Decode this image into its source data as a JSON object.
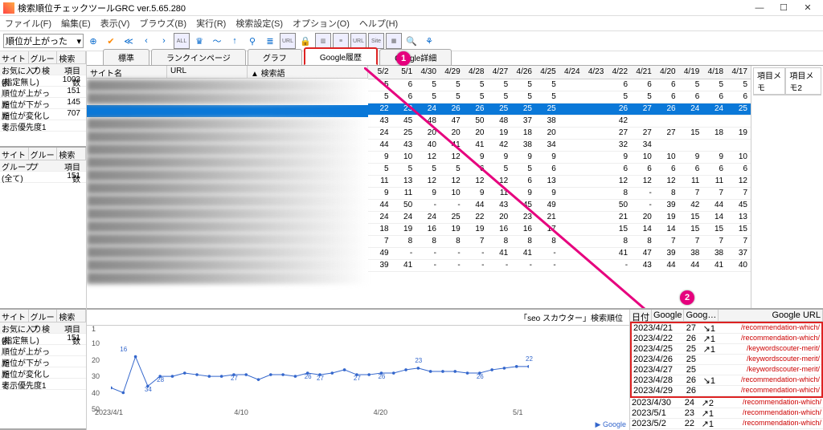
{
  "title": "検索順位チェックツールGRC  ver.5.65.280",
  "menu": [
    "ファイル(F)",
    "編集(E)",
    "表示(V)",
    "ブラウズ(B)",
    "実行(R)",
    "検索設定(S)",
    "オプション(O)",
    "ヘルプ(H)"
  ],
  "dropdown": "順位が上がった",
  "tabs": [
    "標準",
    "ランクインページ",
    "グラフ",
    "Google履歴",
    "Google詳細"
  ],
  "active_tab": 3,
  "badge1": "1",
  "badge2": "2",
  "left_panel1": {
    "head": [
      "サイト",
      "グループ",
      "検索"
    ],
    "subhead": [
      "お気に入り検索",
      "項目数"
    ],
    "rows": [
      [
        "(指定無し)",
        "1003"
      ],
      [
        "順位が上がった",
        "151"
      ],
      [
        "順位が下がった",
        "145"
      ],
      [
        "順位が変化して…",
        "707"
      ],
      [
        "表示優先度1",
        ""
      ]
    ]
  },
  "left_panel2": {
    "head": [
      "サイト",
      "グループ",
      "検索"
    ],
    "subhead": [
      "グループ",
      "項目数"
    ],
    "rows": [
      [
        "(全て)",
        "151"
      ]
    ]
  },
  "left_panel3": {
    "head": [
      "サイト",
      "グループ",
      "検索"
    ],
    "subhead": [
      "お気に入り検索",
      "項目数"
    ],
    "rows": [
      [
        "(指定無し)",
        "151"
      ],
      [
        "順位が上がった",
        ""
      ],
      [
        "順位が下がった",
        ""
      ],
      [
        "順位が変化して…",
        ""
      ],
      [
        "表示優先度1",
        ""
      ]
    ]
  },
  "grid_left_head": [
    "サイト名",
    "URL",
    "▲ 検索語"
  ],
  "memo_tabs": [
    "項目メモ",
    "項目メモ2"
  ],
  "date_cols": [
    "5/2",
    "5/1",
    "4/30",
    "4/29",
    "4/28",
    "4/27",
    "4/26",
    "4/25",
    "4/24",
    "4/23",
    "4/22",
    "4/21",
    "4/20",
    "4/19",
    "4/18",
    "4/17"
  ],
  "rank_rows": [
    [
      5,
      6,
      5,
      5,
      5,
      5,
      5,
      5,
      "",
      "",
      6,
      6,
      6,
      5,
      5,
      5
    ],
    [
      5,
      6,
      5,
      5,
      5,
      5,
      5,
      5,
      "",
      "",
      5,
      5,
      6,
      6,
      6,
      6
    ],
    [
      22,
      23,
      24,
      26,
      26,
      25,
      25,
      25,
      "",
      "",
      26,
      27,
      26,
      24,
      24,
      25
    ],
    [
      43,
      45,
      48,
      47,
      50,
      48,
      37,
      38,
      "",
      "",
      42,
      "",
      "",
      "",
      "",
      ""
    ],
    [
      24,
      25,
      20,
      20,
      20,
      19,
      18,
      20,
      "",
      "",
      27,
      27,
      27,
      15,
      18,
      19
    ],
    [
      44,
      43,
      40,
      41,
      41,
      42,
      38,
      34,
      "",
      "",
      32,
      34,
      "",
      "",
      "",
      ""
    ],
    [
      9,
      10,
      12,
      12,
      9,
      9,
      9,
      9,
      "",
      "",
      9,
      10,
      10,
      9,
      9,
      10
    ],
    [
      5,
      5,
      5,
      5,
      6,
      5,
      5,
      6,
      "",
      "",
      6,
      6,
      6,
      6,
      6,
      6
    ],
    [
      11,
      13,
      12,
      12,
      12,
      12,
      6,
      13,
      "",
      "",
      12,
      12,
      12,
      11,
      11,
      12
    ],
    [
      9,
      11,
      9,
      10,
      9,
      11,
      9,
      9,
      "",
      "",
      8,
      "-",
      8,
      7,
      7,
      7
    ],
    [
      44,
      50,
      "-",
      "-",
      44,
      43,
      45,
      49,
      "",
      "",
      50,
      "-",
      39,
      42,
      44,
      45
    ],
    [
      24,
      24,
      24,
      25,
      22,
      20,
      23,
      21,
      "",
      "",
      21,
      20,
      19,
      15,
      14,
      13
    ],
    [
      18,
      19,
      16,
      19,
      19,
      16,
      16,
      17,
      "",
      "",
      15,
      14,
      14,
      15,
      15,
      15
    ],
    [
      7,
      8,
      8,
      8,
      7,
      8,
      8,
      8,
      "",
      "",
      8,
      8,
      7,
      7,
      7,
      7
    ],
    [
      49,
      "-",
      "-",
      "-",
      "-",
      41,
      41,
      "-",
      "",
      "",
      41,
      47,
      39,
      38,
      38,
      37
    ],
    [
      39,
      41,
      "-",
      "-",
      "-",
      "-",
      "-",
      "-",
      "",
      "",
      "-",
      43,
      44,
      44,
      41,
      40
    ]
  ],
  "sel_row": 2,
  "chart_title": "「seo スカウター」検索順位",
  "chart_data": {
    "type": "line",
    "ylim": [
      1,
      50
    ],
    "y_ticks": [
      1,
      10,
      20,
      30,
      40,
      50
    ],
    "x_ticks": [
      "2023/4/1",
      "4/10",
      "4/20",
      "5/1"
    ],
    "values": [
      35,
      38,
      16,
      34,
      28,
      28,
      26,
      27,
      28,
      28,
      27,
      27,
      30,
      27,
      27,
      28,
      26,
      27,
      26,
      24,
      27,
      27,
      26,
      26,
      24,
      23,
      25,
      25,
      25,
      26,
      26,
      24,
      23,
      22,
      22
    ],
    "labels": [
      [
        1,
        16
      ],
      [
        3,
        34
      ],
      [
        4,
        28
      ],
      [
        10,
        27
      ],
      [
        16,
        26
      ],
      [
        17,
        27
      ],
      [
        20,
        27
      ],
      [
        22,
        26
      ],
      [
        25,
        23
      ],
      [
        30,
        26
      ],
      [
        34,
        22
      ]
    ]
  },
  "google_legend": "▶ Google",
  "hist_head": [
    "日付",
    "Google",
    "Goog…",
    "Google URL"
  ],
  "hist_rows": [
    [
      "2023/4/21",
      "27",
      "↘1",
      "/recommendation-which/"
    ],
    [
      "2023/4/22",
      "26",
      "↗1",
      "/recommendation-which/"
    ],
    [
      "2023/4/25",
      "25",
      "↗1",
      "/keywordscouter-merit/"
    ],
    [
      "2023/4/26",
      "25",
      "",
      "/keywordscouter-merit/"
    ],
    [
      "2023/4/27",
      "25",
      "",
      "/keywordscouter-merit/"
    ],
    [
      "2023/4/28",
      "26",
      "↘1",
      "/recommendation-which/"
    ],
    [
      "2023/4/29",
      "26",
      "",
      "/recommendation-which/"
    ]
  ],
  "hist_rows2": [
    [
      "2023/4/30",
      "24",
      "↗2",
      "/recommendation-which/"
    ],
    [
      "2023/5/1",
      "23",
      "↗1",
      "/recommendation-which/"
    ],
    [
      "2023/5/2",
      "22",
      "↗1",
      "/recommendation-which/"
    ]
  ]
}
